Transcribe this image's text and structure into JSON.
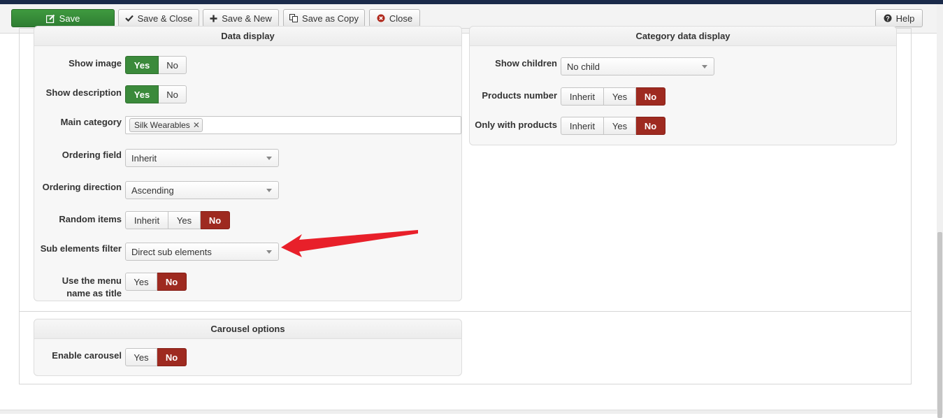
{
  "toolbar": {
    "save": "Save",
    "save_close": "Save & Close",
    "save_new": "Save & New",
    "save_copy": "Save as Copy",
    "close": "Close",
    "help": "Help"
  },
  "data_display": {
    "title": "Data display",
    "show_image": {
      "label": "Show image",
      "options": [
        "Yes",
        "No"
      ],
      "selected": "Yes"
    },
    "show_description": {
      "label": "Show description",
      "options": [
        "Yes",
        "No"
      ],
      "selected": "Yes"
    },
    "main_category": {
      "label": "Main category",
      "tags": [
        "Silk Wearables"
      ]
    },
    "ordering_field": {
      "label": "Ordering field",
      "value": "Inherit"
    },
    "ordering_direction": {
      "label": "Ordering direction",
      "value": "Ascending"
    },
    "random_items": {
      "label": "Random items",
      "options": [
        "Inherit",
        "Yes",
        "No"
      ],
      "selected": "No"
    },
    "sub_elements_filter": {
      "label": "Sub elements filter",
      "value": "Direct sub elements"
    },
    "use_menu_name": {
      "label_line1": "Use the menu",
      "label_line2": "name as title",
      "options": [
        "Yes",
        "No"
      ],
      "selected": "No"
    }
  },
  "category_display": {
    "title": "Category data display",
    "show_children": {
      "label": "Show children",
      "value": "No child"
    },
    "products_number": {
      "label": "Products number",
      "options": [
        "Inherit",
        "Yes",
        "No"
      ],
      "selected": "No"
    },
    "only_with_products": {
      "label": "Only with products",
      "options": [
        "Inherit",
        "Yes",
        "No"
      ],
      "selected": "No"
    }
  },
  "carousel": {
    "title": "Carousel options",
    "enable_carousel": {
      "label": "Enable carousel",
      "options": [
        "Yes",
        "No"
      ],
      "selected": "No"
    }
  },
  "colors": {
    "green": "#3b8a3b",
    "red": "#9e2a20",
    "arrow": "#e8202a"
  }
}
